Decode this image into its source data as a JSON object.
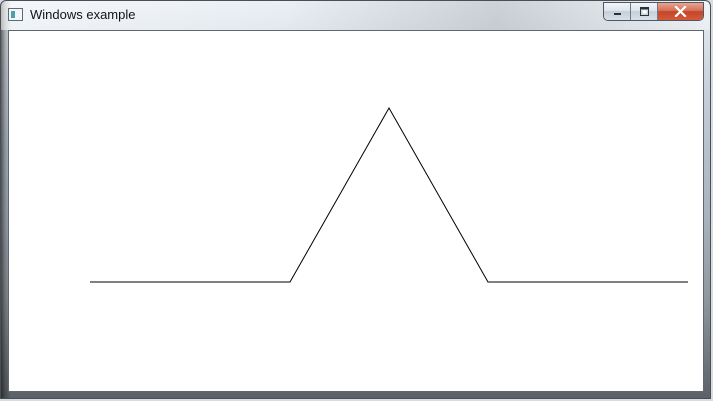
{
  "window": {
    "title": "Windows example"
  },
  "caption_buttons": {
    "minimize_icon": "minimize-icon",
    "maximize_icon": "maximize-icon",
    "close_icon": "close-icon"
  },
  "drawing": {
    "line_color": "#000000",
    "background_color": "#ffffff"
  }
}
